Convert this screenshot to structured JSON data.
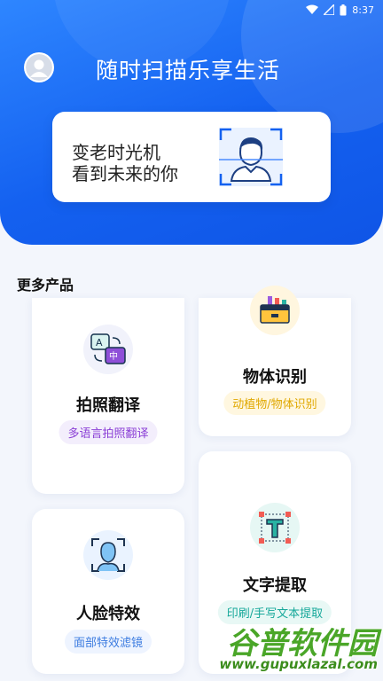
{
  "status_bar": {
    "time": "8:37"
  },
  "header": {
    "title": "随时扫描乐享生活"
  },
  "banner": {
    "line1": "变老时光机",
    "line2": "看到未来的你"
  },
  "section": {
    "title": "更多产品"
  },
  "cards": {
    "photo_translate": {
      "title": "拍照翻译",
      "tag": "多语言拍照翻译",
      "icon": "translate-icon"
    },
    "object_recognition": {
      "title": "物体识别",
      "tag": "动植物/物体识别",
      "icon": "toolbox-icon"
    },
    "face_effects": {
      "title": "人脸特效",
      "tag": "面部特效滤镜",
      "icon": "face-scan-icon"
    },
    "text_extract": {
      "title": "文字提取",
      "tag": "印刷/手写文本提取",
      "icon": "text-frame-icon"
    }
  },
  "watermark": {
    "brand": "谷普软件园",
    "url": "www.gupuxlazal.com"
  },
  "colors": {
    "primary": "#1461f0",
    "translate_tag": "#8b3fd6",
    "object_tag": "#e0a800",
    "face_tag": "#3b7be0",
    "text_tag": "#16a89a"
  }
}
